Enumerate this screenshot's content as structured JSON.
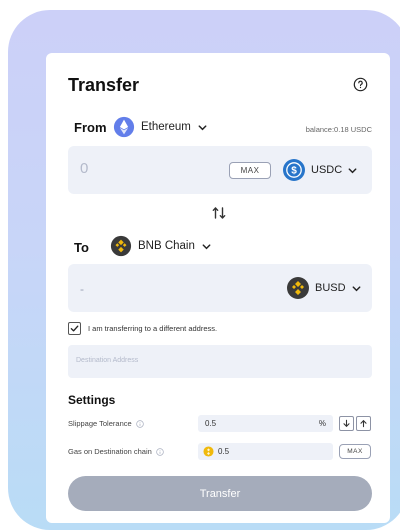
{
  "colors": {
    "brand_gradient_top": "#ccd0f8",
    "brand_gradient_bottom": "#b9dcf6",
    "field_bg": "#eef1f8",
    "button_disabled": "#a5acbb",
    "ethereum": "#627eea",
    "usdc": "#2775ca",
    "bnb": "#f0b90b"
  },
  "header": {
    "title": "Transfer",
    "help_icon": "help-circle-icon"
  },
  "from": {
    "label": "From",
    "chain": "Ethereum",
    "chain_icon": "ethereum-icon",
    "balance": "balance:0.18 USDC",
    "amount": "0",
    "max_label": "MAX",
    "token": "USDC",
    "token_icon": "usdc-icon"
  },
  "swap_icon": "swap-arrows-icon",
  "to": {
    "label": "To",
    "chain": "BNB Chain",
    "chain_icon": "bnb-icon",
    "amount": "-",
    "token": "BUSD",
    "token_icon": "busd-icon"
  },
  "different_address": {
    "checked": true,
    "label": "I am transferring to a different address.",
    "placeholder": "Destination Address"
  },
  "settings": {
    "title": "Settings",
    "slippage": {
      "label": "Slippage Tolerance",
      "value": "0.5",
      "unit": "%"
    },
    "gas": {
      "label": "Gas on Destination chain",
      "value": "0.5",
      "max_label": "MAX"
    }
  },
  "submit_label": "Transfer"
}
